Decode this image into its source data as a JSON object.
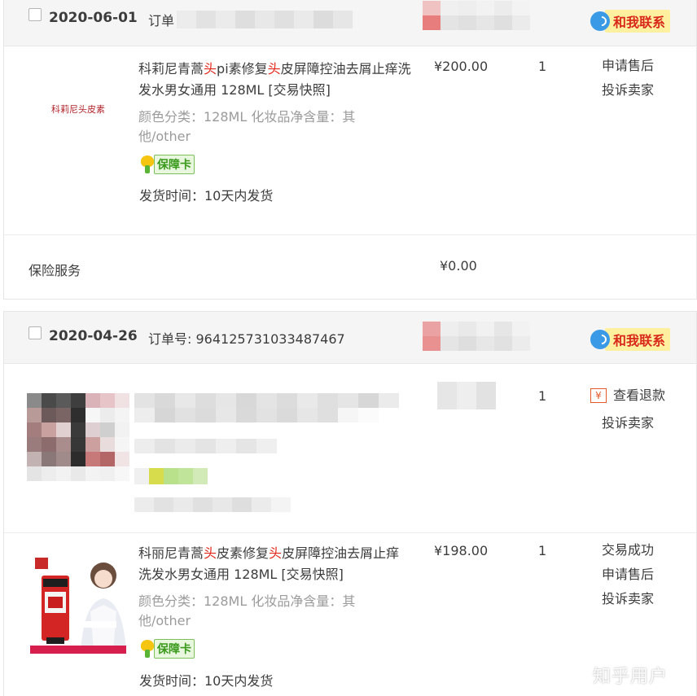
{
  "orders": [
    {
      "date": "2020-06-01",
      "order_no_text": "订单",
      "contact_label": "和我联系",
      "items": [
        {
          "thumb_text": "科莉尼头皮素",
          "title_parts": [
            "科莉尼青蒿",
            "头",
            "pi素修复",
            "头",
            "皮屏障控油去屑止痒洗发水男女通用 128ML [交易快照]"
          ],
          "attrs": "颜色分类：128ML  化妆品净含量：其他/other",
          "badge_label": "保障卡",
          "ship_time": "发货时间：10天内发货",
          "price": "¥200.00",
          "qty": "1",
          "ops": [
            "申请售后",
            "投诉卖家"
          ]
        }
      ],
      "insurance": {
        "label": "保险服务",
        "price": "¥0.00"
      }
    },
    {
      "date": "2020-04-26",
      "order_no_text": "订单号: 964125731033487467",
      "contact_label": "和我联系",
      "items": [
        {
          "qty": "1",
          "ops_refund": "查看退款",
          "ops_refund_icon": "¥",
          "ops_complain": "投诉卖家"
        },
        {
          "title_parts": [
            "科丽尼青蒿",
            "头",
            "皮素修复",
            "头",
            "皮屏障控油去屑止痒洗发水男女通用 128ML [交易快照]"
          ],
          "attrs": "颜色分类：128ML  化妆品净含量：其他/other",
          "badge_label": "保障卡",
          "ship_time": "发货时间：10天内发货",
          "price": "¥198.00",
          "qty": "1",
          "ops": [
            "交易成功",
            "申请售后",
            "投诉卖家"
          ]
        }
      ]
    }
  ],
  "watermark": "知乎用户",
  "colors": {
    "highlight": "#e3261a",
    "contact_bg": "#fff0a0",
    "contact_text": "#d8281a"
  }
}
